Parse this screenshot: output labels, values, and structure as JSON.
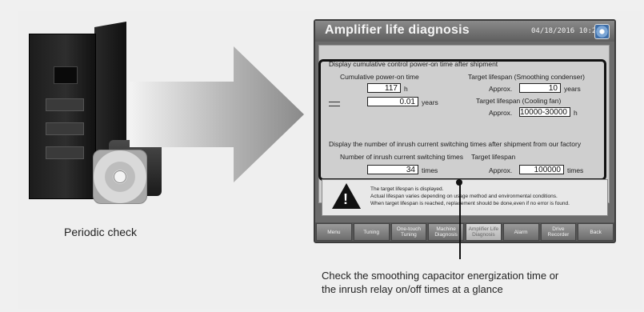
{
  "left_caption": "Periodic check",
  "screen": {
    "title": "Amplifier life diagnosis",
    "datetime": "04/18/2016 10:29",
    "section1_heading": "Display cumulative control power-on time after shipment",
    "cumulative_label": "Cumulative power-on time",
    "hours_value": "117",
    "hours_unit": "h",
    "years_value": "0.01",
    "years_unit": "years",
    "target_condenser_label": "Target lifespan (Smoothing condenser)",
    "approx_label": "Approx.",
    "condenser_value": "10",
    "condenser_unit": "years",
    "target_fan_label": "Target lifespan (Cooling fan)",
    "fan_value": "10000-30000",
    "fan_unit": "h",
    "section2_heading": "Display the number of inrush current switching times after shipment from our factory",
    "inrush_label": "Number of inrush current switching times",
    "inrush_value": "34",
    "inrush_unit": "times",
    "target_inrush_label": "Target lifespan",
    "target_inrush_value": "100000",
    "target_inrush_unit": "times",
    "warning_lines": [
      "The target lifespan is displayed.",
      "Actual lifespan varies depending on usage method and environmental conditions.",
      "When target lifespan is reached, replacement should be done,even if no error is found."
    ],
    "nav": [
      {
        "label": "Menu"
      },
      {
        "label": "Tuning"
      },
      {
        "label": "One-touch\nTuning"
      },
      {
        "label": "Machine\nDiagnosis"
      },
      {
        "label": "Amplifier Life\nDiagnosis"
      },
      {
        "label": "Alarm"
      },
      {
        "label": "Drive\nRecorder"
      },
      {
        "label": "Back"
      }
    ]
  },
  "callout": {
    "line1": "Check the smoothing capacitor energization time or",
    "line2": "the inrush relay on/off times at a glance"
  }
}
